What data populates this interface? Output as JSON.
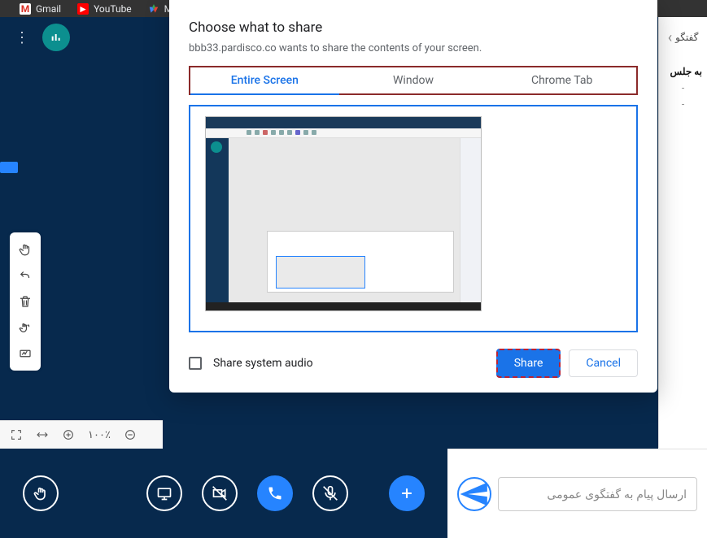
{
  "bookmarks": {
    "gmail": "Gmail",
    "youtube": "YouTube",
    "maps": "Ma"
  },
  "side": {
    "header_label": "گفتگو",
    "welcome": "به جلس",
    "dash": "-"
  },
  "chat": {
    "placeholder": "ارسال پیام به گفتگوی عمومی"
  },
  "viewer": {
    "zoom_label": "۱۰۰٪"
  },
  "modal": {
    "title": "Choose what to share",
    "subtitle": "bbb33.pardisco.co wants to share the contents of your screen.",
    "tabs": {
      "entire": "Entire Screen",
      "window": "Window",
      "chrome": "Chrome Tab"
    },
    "share_audio": "Share system audio",
    "share_btn": "Share",
    "cancel_btn": "Cancel"
  }
}
